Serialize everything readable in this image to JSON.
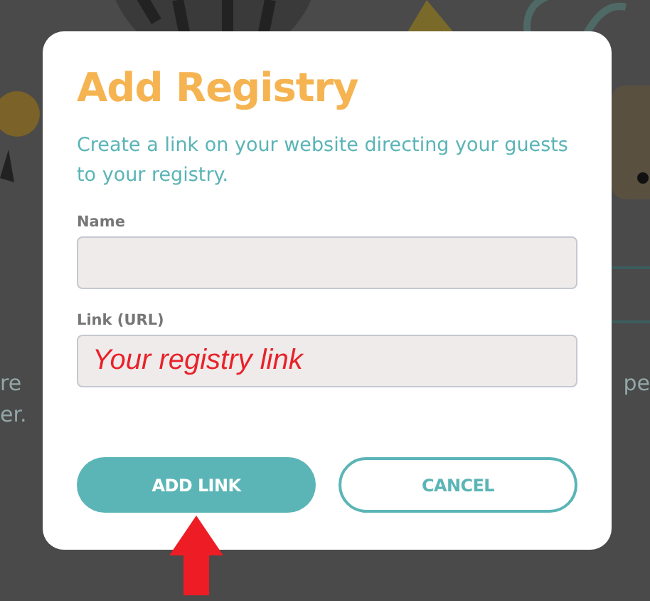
{
  "background_text": {
    "left": [
      "re",
      "er."
    ],
    "right": [
      "pe"
    ]
  },
  "dialog": {
    "title": "Add Registry",
    "description": "Create a link on your website directing your guests to your registry.",
    "fields": [
      {
        "label": "Name"
      },
      {
        "label": "Link (URL)",
        "value": "Your registry link"
      }
    ],
    "buttons": [
      {
        "label": "ADD LINK",
        "kind": "primary"
      },
      {
        "label": "CANCEL",
        "kind": "secondary"
      }
    ]
  }
}
